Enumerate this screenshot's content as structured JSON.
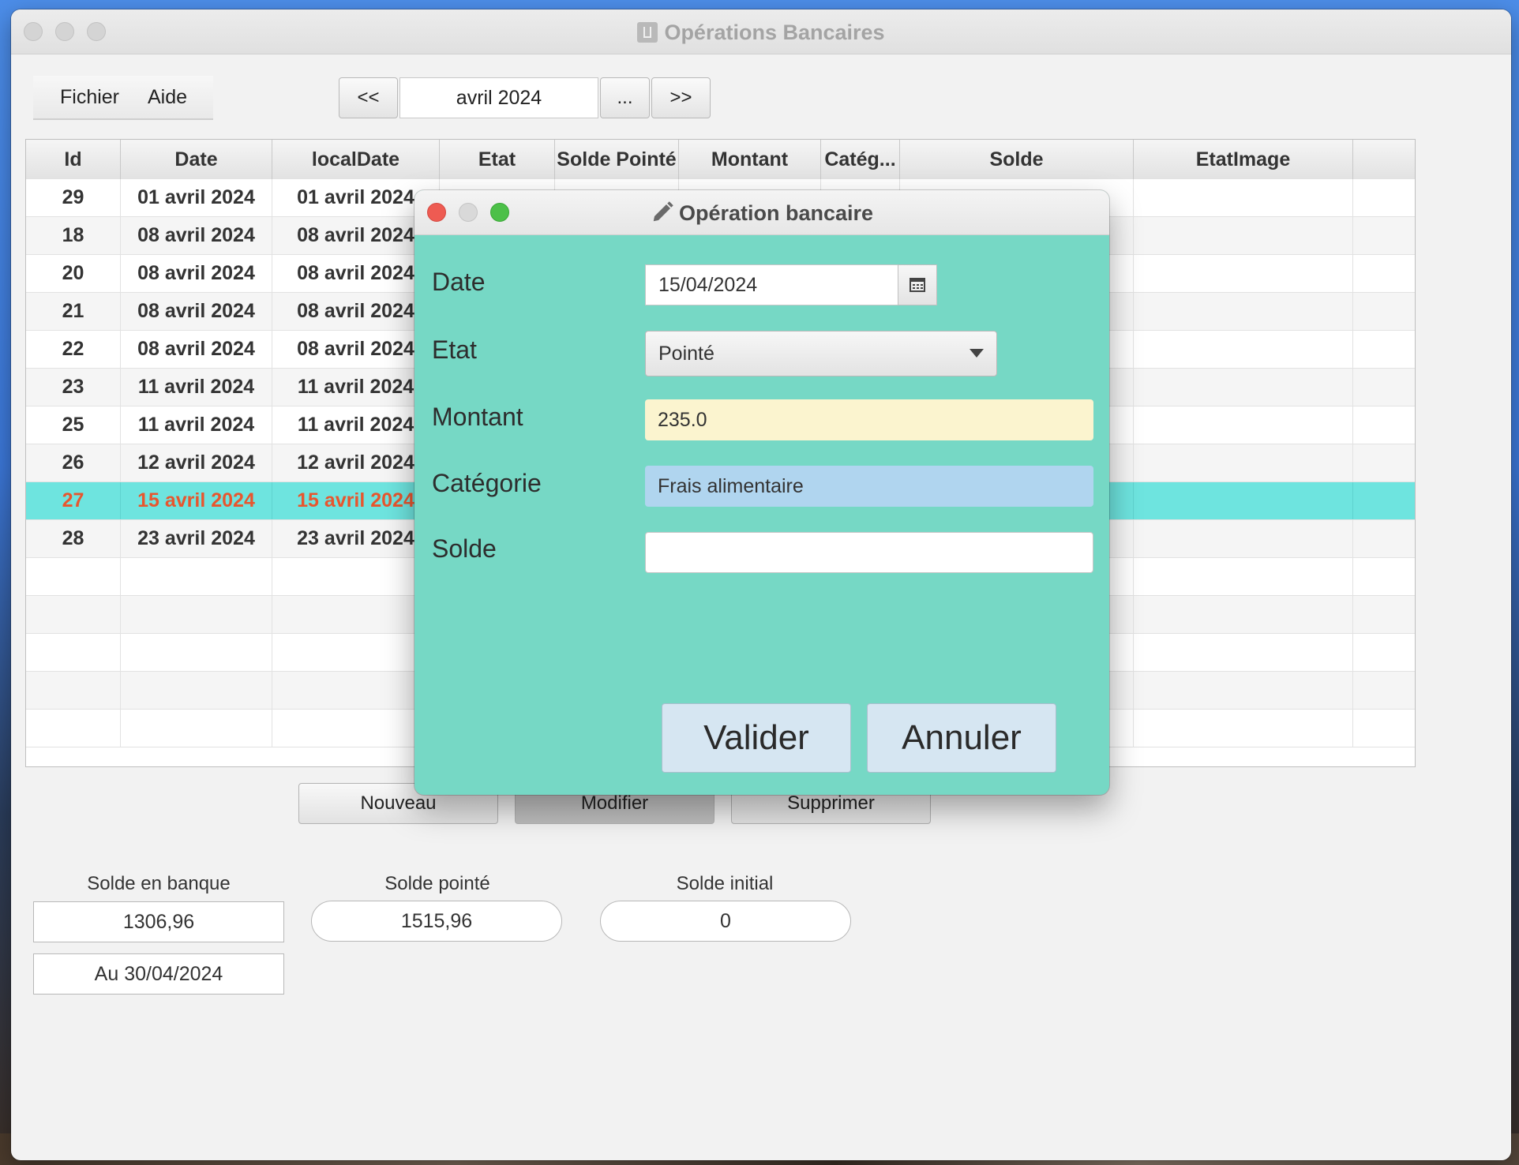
{
  "window": {
    "title": "Opérations Bancaires"
  },
  "menu": {
    "file": "Fichier",
    "help": "Aide"
  },
  "month_nav": {
    "prev": "<<",
    "current": "avril 2024",
    "pick": "...",
    "next": ">>"
  },
  "table": {
    "columns": [
      "Id",
      "Date",
      "localDate",
      "Etat",
      "Solde Pointé",
      "Montant",
      "Catég...",
      "Solde",
      "EtatImage"
    ],
    "rows": [
      {
        "id": "29",
        "date": "01 avril 2024",
        "localDate": "01 avril 2024"
      },
      {
        "id": "18",
        "date": "08 avril 2024",
        "localDate": "08 avril 2024"
      },
      {
        "id": "20",
        "date": "08 avril 2024",
        "localDate": "08 avril 2024"
      },
      {
        "id": "21",
        "date": "08 avril 2024",
        "localDate": "08 avril 2024"
      },
      {
        "id": "22",
        "date": "08 avril 2024",
        "localDate": "08 avril 2024"
      },
      {
        "id": "23",
        "date": "11 avril 2024",
        "localDate": "11 avril 2024"
      },
      {
        "id": "25",
        "date": "11 avril 2024",
        "localDate": "11 avril 2024"
      },
      {
        "id": "26",
        "date": "12 avril 2024",
        "localDate": "12 avril 2024"
      },
      {
        "id": "27",
        "date": "15 avril 2024",
        "localDate": "15 avril 2024",
        "selected": true
      },
      {
        "id": "28",
        "date": "23 avril 2024",
        "localDate": "23 avril 2024"
      }
    ]
  },
  "actions": {
    "new": "Nouveau",
    "edit": "Modifier",
    "delete": "Supprimer"
  },
  "balances": {
    "bank_label": "Solde en banque",
    "bank_value": "1306,96",
    "as_of": "Au 30/04/2024",
    "checked_label": "Solde pointé",
    "checked_value": "1515,96",
    "initial_label": "Solde initial",
    "initial_value": "0"
  },
  "dialog": {
    "title": "Opération bancaire",
    "date_label": "Date",
    "date_value": "15/04/2024",
    "state_label": "Etat",
    "state_value": "Pointé",
    "amount_label": "Montant",
    "amount_value": "235.0",
    "category_label": "Catégorie",
    "category_value": "Frais alimentaire",
    "balance_label": "Solde",
    "balance_value": "",
    "validate": "Valider",
    "cancel": "Annuler"
  },
  "colors": {
    "dialog_bg": "#76d8c5",
    "selected_row": "#6ee4df",
    "selected_text": "#e8562e",
    "amount_field": "#fbf4cf",
    "category_field": "#b0d5ef"
  },
  "icons": [
    "calendar-icon",
    "dropdown-arrow-icon",
    "pencil-icon",
    "window-icon"
  ]
}
